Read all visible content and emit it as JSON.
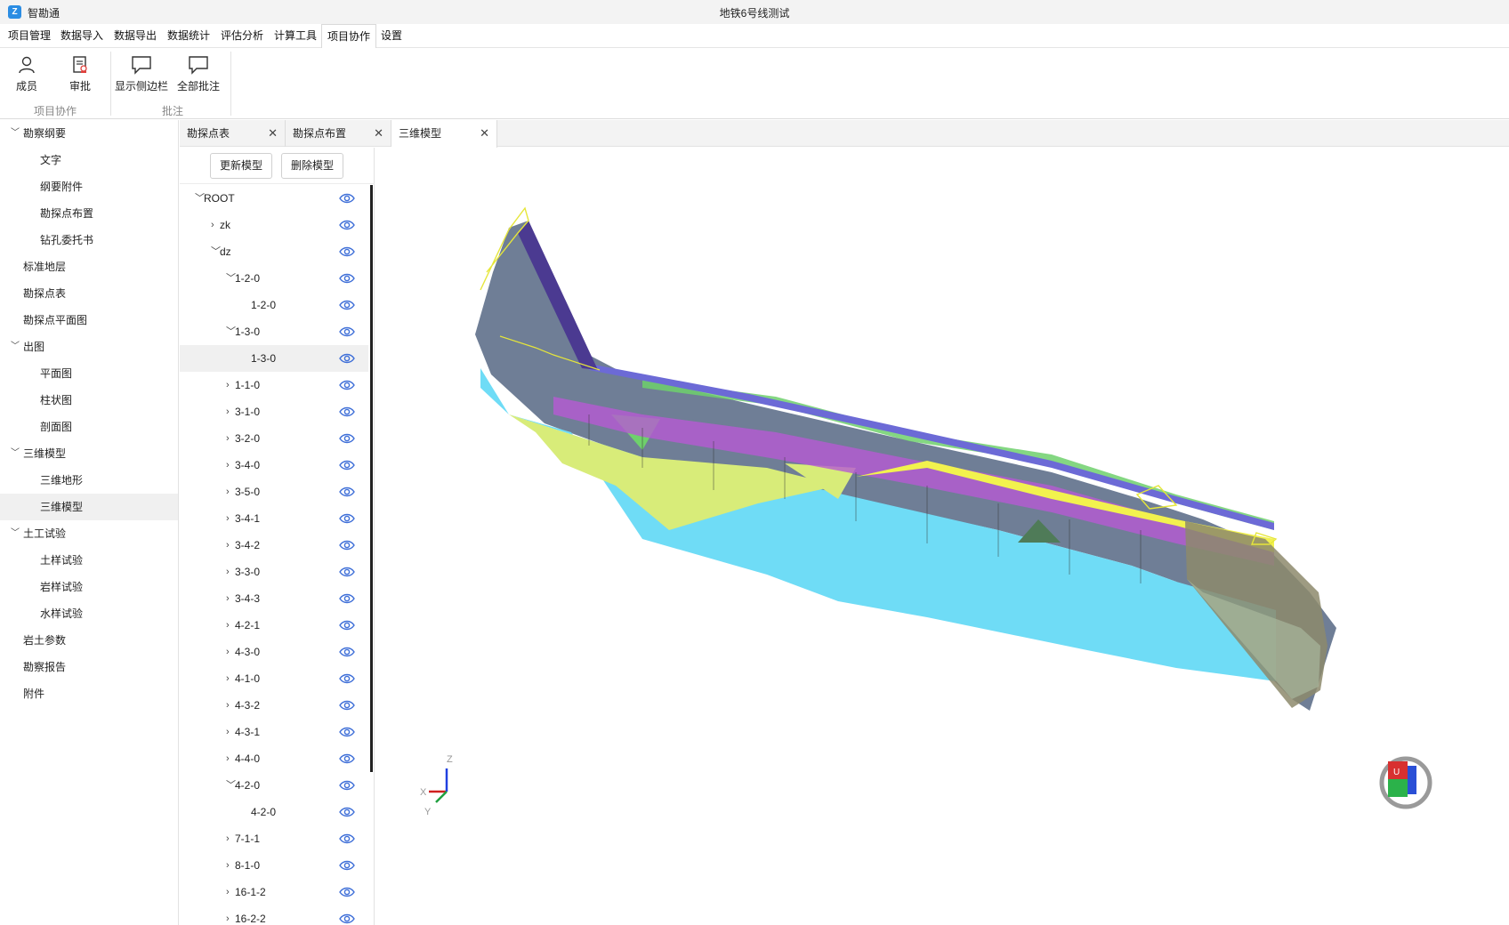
{
  "app": {
    "name": "智勘通",
    "logo_glyph": "Z",
    "window_title": "地铁6号线测试"
  },
  "menu": [
    {
      "label": "项目管理"
    },
    {
      "label": "数据导入"
    },
    {
      "label": "数据导出"
    },
    {
      "label": "数据统计"
    },
    {
      "label": "评估分析"
    },
    {
      "label": "计算工具"
    },
    {
      "label": "项目协作",
      "active": true
    },
    {
      "label": "设置"
    }
  ],
  "ribbon": {
    "members_label": "成员",
    "approve_label": "审批",
    "sidebar_label": "显示侧边栏",
    "all_notes_label": "全部批注",
    "group_collab": "项目协作",
    "group_notes": "批注"
  },
  "nav": [
    {
      "label": "勘察纲要",
      "expanded": true
    },
    {
      "label": "文字"
    },
    {
      "label": "纲要附件"
    },
    {
      "label": "勘探点布置"
    },
    {
      "label": "钻孔委托书"
    },
    {
      "label": "标准地层"
    },
    {
      "label": "勘探点表"
    },
    {
      "label": "勘探点平面图"
    },
    {
      "label": "出图",
      "expanded": true
    },
    {
      "label": "平面图"
    },
    {
      "label": "柱状图"
    },
    {
      "label": "剖面图"
    },
    {
      "label": "三维模型",
      "expanded": true
    },
    {
      "label": "三维地形"
    },
    {
      "label": "三维模型",
      "selected": true
    },
    {
      "label": "土工试验",
      "expanded": true
    },
    {
      "label": "土样试验"
    },
    {
      "label": "岩样试验"
    },
    {
      "label": "水样试验"
    },
    {
      "label": "岩土参数"
    },
    {
      "label": "勘察报告"
    },
    {
      "label": "附件"
    }
  ],
  "tabs": [
    {
      "label": "勘探点表"
    },
    {
      "label": "勘探点布置"
    },
    {
      "label": "三维模型",
      "active": true
    }
  ],
  "tree_panel": {
    "update_label": "更新模型",
    "delete_label": "删除模型",
    "nodes": [
      {
        "label": "ROOT",
        "level": 0,
        "state": "open"
      },
      {
        "label": "zk",
        "level": 1,
        "state": "closed"
      },
      {
        "label": "dz",
        "level": 1,
        "state": "open"
      },
      {
        "label": "1-2-0",
        "level": 2,
        "state": "open"
      },
      {
        "label": "1-2-0",
        "level": 3,
        "state": "leaf"
      },
      {
        "label": "1-3-0",
        "level": 2,
        "state": "open"
      },
      {
        "label": "1-3-0",
        "level": 3,
        "state": "leaf",
        "selected": true
      },
      {
        "label": "1-1-0",
        "level": 2,
        "state": "closed"
      },
      {
        "label": "3-1-0",
        "level": 2,
        "state": "closed"
      },
      {
        "label": "3-2-0",
        "level": 2,
        "state": "closed"
      },
      {
        "label": "3-4-0",
        "level": 2,
        "state": "closed"
      },
      {
        "label": "3-5-0",
        "level": 2,
        "state": "closed"
      },
      {
        "label": "3-4-1",
        "level": 2,
        "state": "closed"
      },
      {
        "label": "3-4-2",
        "level": 2,
        "state": "closed"
      },
      {
        "label": "3-3-0",
        "level": 2,
        "state": "closed"
      },
      {
        "label": "3-4-3",
        "level": 2,
        "state": "closed"
      },
      {
        "label": "4-2-1",
        "level": 2,
        "state": "closed"
      },
      {
        "label": "4-3-0",
        "level": 2,
        "state": "closed"
      },
      {
        "label": "4-1-0",
        "level": 2,
        "state": "closed"
      },
      {
        "label": "4-3-2",
        "level": 2,
        "state": "closed"
      },
      {
        "label": "4-3-1",
        "level": 2,
        "state": "closed"
      },
      {
        "label": "4-4-0",
        "level": 2,
        "state": "closed"
      },
      {
        "label": "4-2-0",
        "level": 2,
        "state": "open"
      },
      {
        "label": "4-2-0",
        "level": 3,
        "state": "leaf"
      },
      {
        "label": "7-1-1",
        "level": 2,
        "state": "closed"
      },
      {
        "label": "8-1-0",
        "level": 2,
        "state": "closed"
      },
      {
        "label": "16-1-2",
        "level": 2,
        "state": "closed"
      },
      {
        "label": "16-2-2",
        "level": 2,
        "state": "closed"
      }
    ]
  },
  "viewport": {
    "axis_x": "X",
    "axis_y": "Y",
    "axis_z": "Z",
    "cube_face": "U",
    "colors": {
      "top": "#6f7e96",
      "cyan": "#6fdcf6",
      "yellow_green": "#d8ec79",
      "magenta": "#b75ad3",
      "purple": "#4b3a91",
      "green": "#6fd06c",
      "yellow": "#f2f24e",
      "outline": "#e6e63a",
      "eye": "#3f6fd8"
    }
  }
}
